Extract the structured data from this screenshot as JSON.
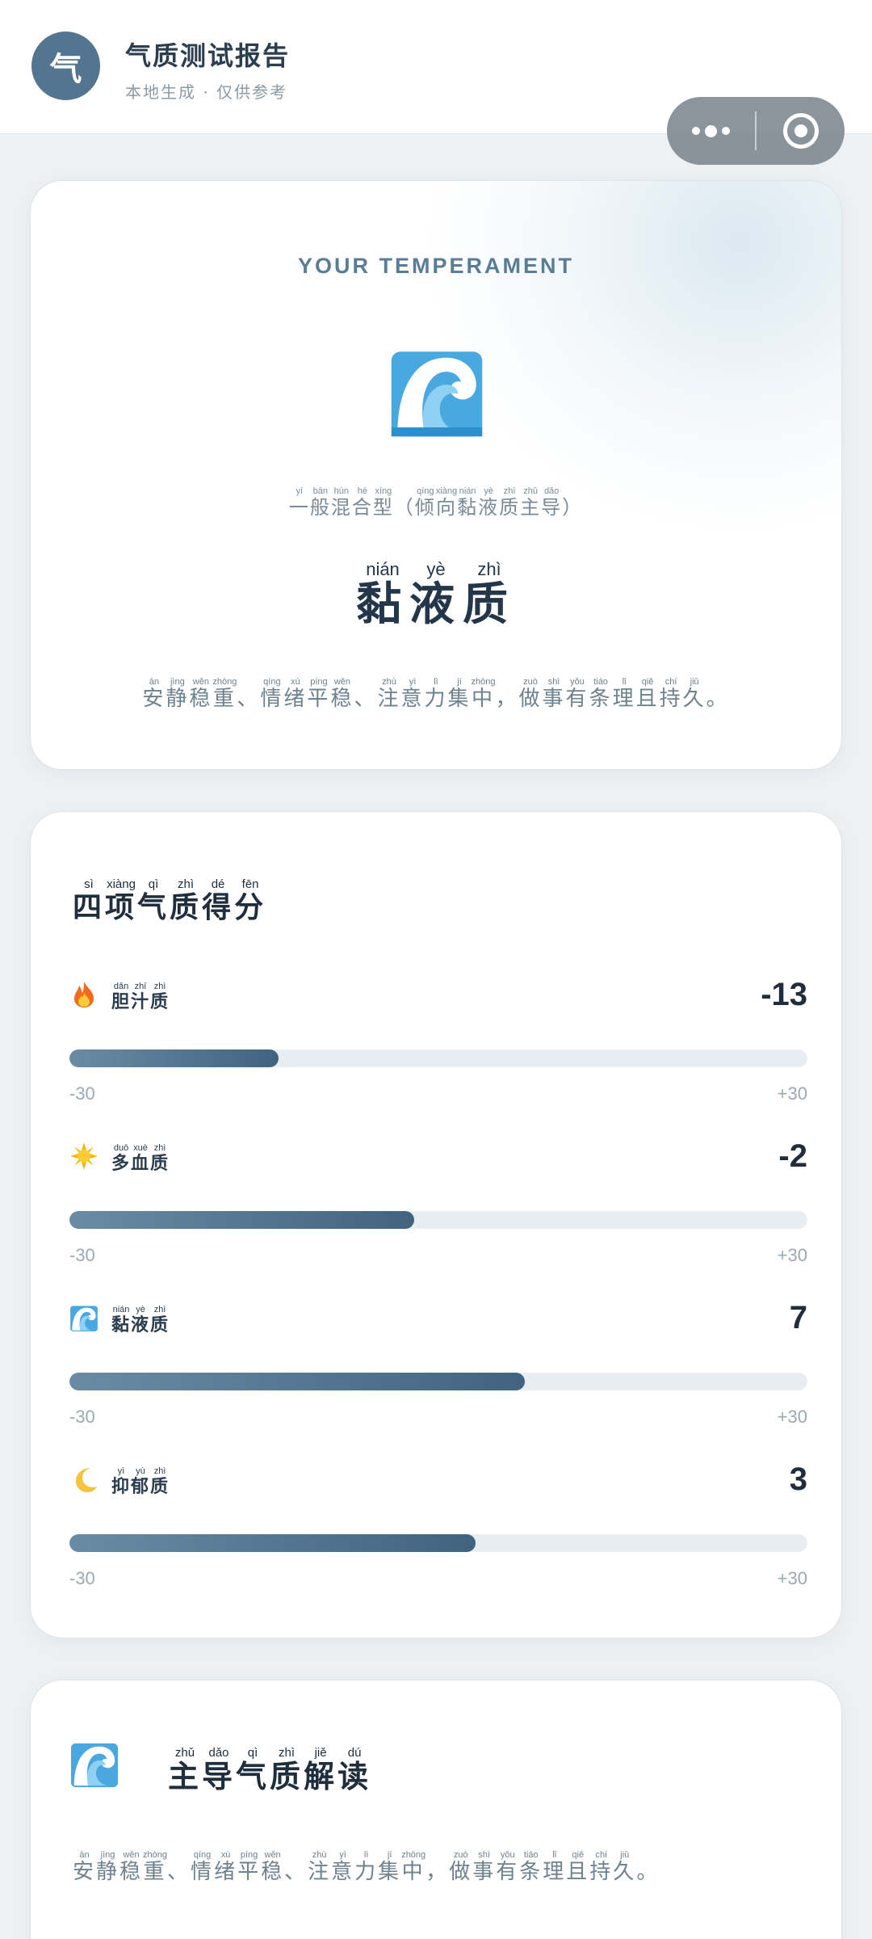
{
  "header": {
    "logo_char": "气",
    "title": "气质测试报告",
    "subtitle": "本地生成 · 仅供参考"
  },
  "result": {
    "kicker": "YOUR TEMPERAMENT",
    "icon": "wave-icon",
    "pattern": [
      {
        "t": "一",
        "p": "yī"
      },
      {
        "t": "般",
        "p": "bān"
      },
      {
        "t": "混",
        "p": "hùn"
      },
      {
        "t": "合",
        "p": "hé"
      },
      {
        "t": "型",
        "p": "xíng"
      },
      {
        "t": "（",
        "p": ""
      },
      {
        "t": "倾",
        "p": "qīng"
      },
      {
        "t": "向",
        "p": "xiàng"
      },
      {
        "t": "黏",
        "p": "nián"
      },
      {
        "t": "液",
        "p": "yè"
      },
      {
        "t": "质",
        "p": "zhì"
      },
      {
        "t": "主",
        "p": "zhǔ"
      },
      {
        "t": "导",
        "p": "dǎo"
      },
      {
        "t": "）",
        "p": ""
      }
    ],
    "type_name": [
      {
        "t": "黏",
        "p": "nián"
      },
      {
        "t": "液",
        "p": "yè"
      },
      {
        "t": "质",
        "p": "zhì"
      }
    ],
    "description": [
      {
        "t": "安",
        "p": "ān"
      },
      {
        "t": "静",
        "p": "jìng"
      },
      {
        "t": "稳",
        "p": "wěn"
      },
      {
        "t": "重",
        "p": "zhòng"
      },
      {
        "t": "、",
        "p": ""
      },
      {
        "t": "情",
        "p": "qíng"
      },
      {
        "t": "绪",
        "p": "xù"
      },
      {
        "t": "平",
        "p": "píng"
      },
      {
        "t": "稳",
        "p": "wěn"
      },
      {
        "t": "、",
        "p": ""
      },
      {
        "t": "注",
        "p": "zhù"
      },
      {
        "t": "意",
        "p": "yì"
      },
      {
        "t": "力",
        "p": "lì"
      },
      {
        "t": "集",
        "p": "jí"
      },
      {
        "t": "中",
        "p": "zhōng"
      },
      {
        "t": "，",
        "p": ""
      },
      {
        "t": "做",
        "p": "zuò"
      },
      {
        "t": "事",
        "p": "shì"
      },
      {
        "t": "有",
        "p": "yǒu"
      },
      {
        "t": "条",
        "p": "tiáo"
      },
      {
        "t": "理",
        "p": "lǐ"
      },
      {
        "t": "且",
        "p": "qiě"
      },
      {
        "t": "持",
        "p": "chí"
      },
      {
        "t": "久",
        "p": "jiǔ"
      },
      {
        "t": "。",
        "p": ""
      }
    ]
  },
  "scores": {
    "title": [
      {
        "t": "四",
        "p": "sì"
      },
      {
        "t": "项",
        "p": "xiàng"
      },
      {
        "t": "气",
        "p": "qì"
      },
      {
        "t": "质",
        "p": "zhì"
      },
      {
        "t": "得",
        "p": "dé"
      },
      {
        "t": "分",
        "p": "fēn"
      }
    ],
    "min_label": "-30",
    "max_label": "+30",
    "items": [
      {
        "icon": "fire-icon",
        "label": [
          {
            "t": "胆",
            "p": "dǎn"
          },
          {
            "t": "汁",
            "p": "zhī"
          },
          {
            "t": "质",
            "p": "zhì"
          }
        ],
        "value": "-13",
        "fill_fraction": 0.283
      },
      {
        "icon": "sun-icon",
        "label": [
          {
            "t": "多",
            "p": "duō"
          },
          {
            "t": "血",
            "p": "xuè"
          },
          {
            "t": "质",
            "p": "zhì"
          }
        ],
        "value": "-2",
        "fill_fraction": 0.467
      },
      {
        "icon": "wave-icon",
        "label": [
          {
            "t": "黏",
            "p": "nián"
          },
          {
            "t": "液",
            "p": "yè"
          },
          {
            "t": "质",
            "p": "zhì"
          }
        ],
        "value": "7",
        "fill_fraction": 0.617
      },
      {
        "icon": "moon-icon",
        "label": [
          {
            "t": "抑",
            "p": "yì"
          },
          {
            "t": "郁",
            "p": "yù"
          },
          {
            "t": "质",
            "p": "zhì"
          }
        ],
        "value": "3",
        "fill_fraction": 0.55
      }
    ]
  },
  "dominant": {
    "icon": "wave-icon",
    "title": [
      {
        "t": "主",
        "p": "zhǔ"
      },
      {
        "t": "导",
        "p": "dǎo"
      },
      {
        "t": "气",
        "p": "qì"
      },
      {
        "t": "质",
        "p": "zhì"
      },
      {
        "t": "解",
        "p": "jiě"
      },
      {
        "t": "读",
        "p": "dú"
      }
    ],
    "description": [
      {
        "t": "安",
        "p": "ān"
      },
      {
        "t": "静",
        "p": "jìng"
      },
      {
        "t": "稳",
        "p": "wěn"
      },
      {
        "t": "重",
        "p": "zhòng"
      },
      {
        "t": "、",
        "p": ""
      },
      {
        "t": "情",
        "p": "qíng"
      },
      {
        "t": "绪",
        "p": "xù"
      },
      {
        "t": "平",
        "p": "píng"
      },
      {
        "t": "稳",
        "p": "wěn"
      },
      {
        "t": "、",
        "p": ""
      },
      {
        "t": "注",
        "p": "zhù"
      },
      {
        "t": "意",
        "p": "yì"
      },
      {
        "t": "力",
        "p": "lì"
      },
      {
        "t": "集",
        "p": "jí"
      },
      {
        "t": "中",
        "p": "zhōng"
      },
      {
        "t": "，",
        "p": ""
      },
      {
        "t": "做",
        "p": "zuò"
      },
      {
        "t": "事",
        "p": "shì"
      },
      {
        "t": "有",
        "p": "yǒu"
      },
      {
        "t": "条",
        "p": "tiáo"
      },
      {
        "t": "理",
        "p": "lǐ"
      },
      {
        "t": "且",
        "p": "qiě"
      },
      {
        "t": "持",
        "p": "chí"
      },
      {
        "t": "久",
        "p": "jiǔ"
      },
      {
        "t": "。",
        "p": ""
      }
    ]
  },
  "colors": {
    "accent": "#54758f",
    "bar_start": "#6a8ba4",
    "bar_end": "#40647f",
    "track": "#e8edf1"
  }
}
